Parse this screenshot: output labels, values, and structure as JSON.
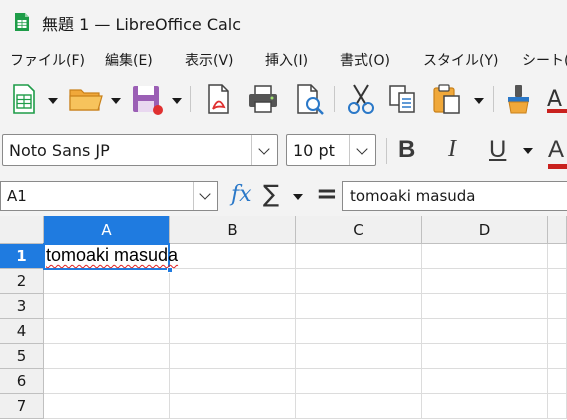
{
  "window": {
    "title": "無題 1 — LibreOffice Calc"
  },
  "menu": [
    "ファイル(F)",
    "編集(E)",
    "表示(V)",
    "挿入(I)",
    "書式(O)",
    "スタイル(Y)",
    "シート("
  ],
  "toolbar": {
    "icons": [
      "new-spreadsheet-icon",
      "open-folder-icon",
      "save-icon",
      "export-pdf-icon",
      "print-icon",
      "print-preview-icon",
      "cut-icon",
      "copy-icon",
      "paste-icon",
      "clone-formatting-icon",
      "font-color-icon"
    ]
  },
  "formatting": {
    "font_name": "Noto Sans JP",
    "font_size": "10 pt",
    "bold": "B",
    "italic": "I",
    "underline": "U",
    "font_color_letter": "A"
  },
  "formula_bar": {
    "name_box": "A1",
    "fx": "fx",
    "sigma": "∑",
    "equals": "=",
    "content": "tomoaki masuda"
  },
  "sheet": {
    "columns": [
      "A",
      "B",
      "C",
      "D"
    ],
    "rows": [
      "1",
      "2",
      "3",
      "4",
      "5",
      "6",
      "7"
    ],
    "selected_cell": "A1",
    "cells": {
      "A1": "tomoaki masuda"
    }
  },
  "colors": {
    "accent": "#1f7be0",
    "toolbar_bg": "#f3f3f3",
    "spell_error": "#dd2222"
  }
}
